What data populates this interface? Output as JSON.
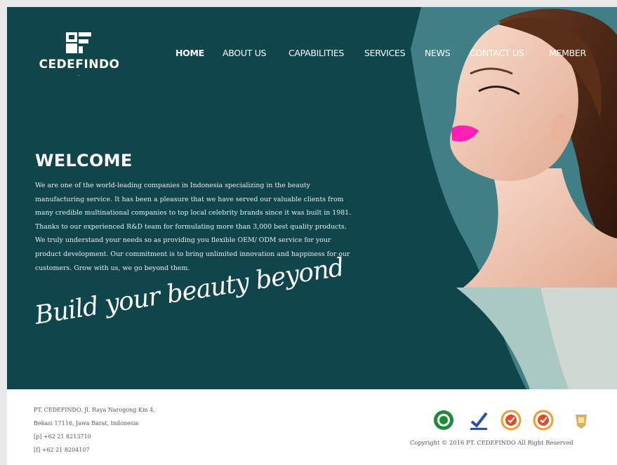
{
  "brand": {
    "name": "CEDEFINDO",
    "colors": {
      "hero_bg": "#0f454b",
      "text": "#ffffff",
      "accent_lips": "#ff1fb4"
    }
  },
  "nav": {
    "items": [
      {
        "label": "HOME",
        "active": true
      },
      {
        "label": "ABOUT US",
        "active": false
      },
      {
        "label": "CAPABILITIES",
        "active": false
      },
      {
        "label": "SERVICES",
        "active": false
      },
      {
        "label": "NEWS",
        "active": false
      },
      {
        "label": "CONTACT US",
        "active": false
      },
      {
        "label": "MEMBER",
        "active": false
      }
    ]
  },
  "hero": {
    "title": "WELCOME",
    "body": "We are one of the world-leading companies in Indonesia specializing in the beauty manufacturing service. It has been a pleasure that we have served our valuable clients from many credible multinational companies to top local celebrity brands since it was built in 1981. Thanks to our experienced R&D team for formulating more than 3,000 best quality products. We truly understand your needs so as providing you flexible OEM/ ODM service for your product development. Our commitment is to bring unlimited innovation and happiness for our customers. Grow with us, we go beyond them.",
    "tagline": "Build your beauty beyond"
  },
  "footer": {
    "address_lines": [
      "PT. CEDEFINDO. Jl. Raya Narogong Km 4,",
      "Bekasi 17116, Jawa Barat, Indonesia",
      "[p] +62 21 8213710",
      "[f] +62 21 8204107"
    ],
    "badges": [
      "halal-certification-icon",
      "check-certification-icon",
      "quality-seal-icon",
      "quality-seal-icon",
      "gold-crest-icon"
    ],
    "copyright": "Copyright © 2016 PT. CEDEFINDO All Right Reserved"
  }
}
